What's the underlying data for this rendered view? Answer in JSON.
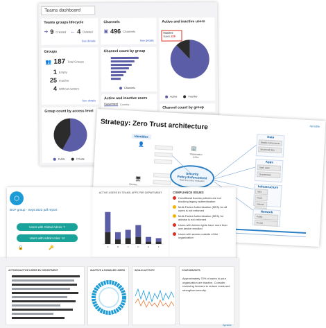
{
  "dashboard": {
    "title": "Teams dashboard",
    "lifecycle": {
      "title": "Teams groups lifecycle",
      "created_num": "9",
      "created_label": "Created",
      "deleted_num": "4",
      "deleted_label": "Deleted",
      "link": "See details"
    },
    "channels": {
      "title": "Channels",
      "num": "496",
      "label": "Channels",
      "link": "See details"
    },
    "active_inactive": {
      "title": "Active and inactive users",
      "tooltip_label": "Inactive",
      "tooltip_line2": "Users",
      "tooltip_value": "226",
      "legend_active": "Active",
      "legend_inactive": "Inactive"
    },
    "groups": {
      "title": "Groups",
      "total_num": "187",
      "total_label": "Total Groups",
      "empty_num": "1",
      "empty_label": "Empty",
      "inactive_num": "25",
      "inactive_label": "Inactive",
      "noowner_num": "4",
      "noowner_label": "Without owners",
      "link": "See details"
    },
    "channel_count": {
      "title": "Channel count by group",
      "legend": "Channels"
    },
    "active_inactive2": {
      "title": "Active and inactive users",
      "tab1": "Department",
      "tab2": "Country"
    },
    "access_level": {
      "title": "Group count by access level",
      "legend_public": "Public",
      "legend_private": "Private"
    },
    "channel_count2": {
      "title": "Channel count by group"
    },
    "colors": {
      "accent": "#5b5ea6",
      "dark": "#2b2b2b",
      "tooltip_border": "#d93025"
    }
  },
  "zero_trust": {
    "title": "Strategy: Zero Trust architecture",
    "identities": "Identities",
    "devices": "Devices",
    "center_line1": "Security",
    "center_line2": "Policy Enforcement",
    "center_sub": "Real-time policy evaluation",
    "org_policy": "Organization policy",
    "data": "Data",
    "data_items": [
      "Emails & documents",
      "Structured data"
    ],
    "apps": "Apps",
    "apps_items": [
      "SaaS apps",
      "On-premises"
    ],
    "infrastructure": "Infrastructure",
    "infra_items": [
      "IaaS",
      "PaaS",
      "Internal",
      "Sites"
    ],
    "network": "Network",
    "network_items": [
      "Public",
      "Private"
    ],
    "logo": "Apriable"
  },
  "report": {
    "org": "BCP group - Sept 2022 pdf report",
    "btn1": "Users with Global Admin: 7",
    "btn2": "Users with Admin roles: 12",
    "chart_title": "ACTIVE USERS BY TEAMS, APPS PER DEPARTMENT",
    "compliance_title": "COMPLIANCE ISSUES",
    "compliance": [
      "Conditional Access policies are not blocking legacy authentication",
      "Multi-Factor Authentication (MFA) for all users is not enforced",
      "Multi-Factor Authentication (MFA) for admins is not enforced",
      "Users with Admin rights have more than one device enrolled",
      "Users with access outside of the organization"
    ],
    "colors": {
      "accent": "#1aa39a",
      "bar": "#5b5ea6"
    }
  },
  "bottom": {
    "card1": "ACTIVE/INACTIVE USERS BY DEPARTMENT",
    "card2": "INACTIVE & DISABLED USERS",
    "card3": "SIGN-IN ACTIVITY",
    "card4_title": "YOUR INSIGHTS",
    "card4_text": "Approximately 70% of users in your organization are inactive. Consider reviewing licenses to reduce costs and strengthen security.",
    "logo": "Apriable"
  },
  "chart_data": [
    {
      "type": "bar",
      "categories": [
        "A",
        "B",
        "C",
        "D",
        "E",
        "F"
      ],
      "series": [
        {
          "values": [
            27,
            10,
            12,
            16,
            6,
            5
          ]
        },
        {
          "values": [
            10,
            4,
            5,
            6,
            2,
            2
          ]
        }
      ],
      "ylim": [
        0,
        35
      ]
    },
    {
      "type": "pie",
      "labels": [
        "Public",
        "Private"
      ],
      "values": [
        58,
        42
      ]
    },
    {
      "type": "pie",
      "labels": [
        "Active",
        "Inactive"
      ],
      "values": [
        88,
        12
      ]
    }
  ]
}
